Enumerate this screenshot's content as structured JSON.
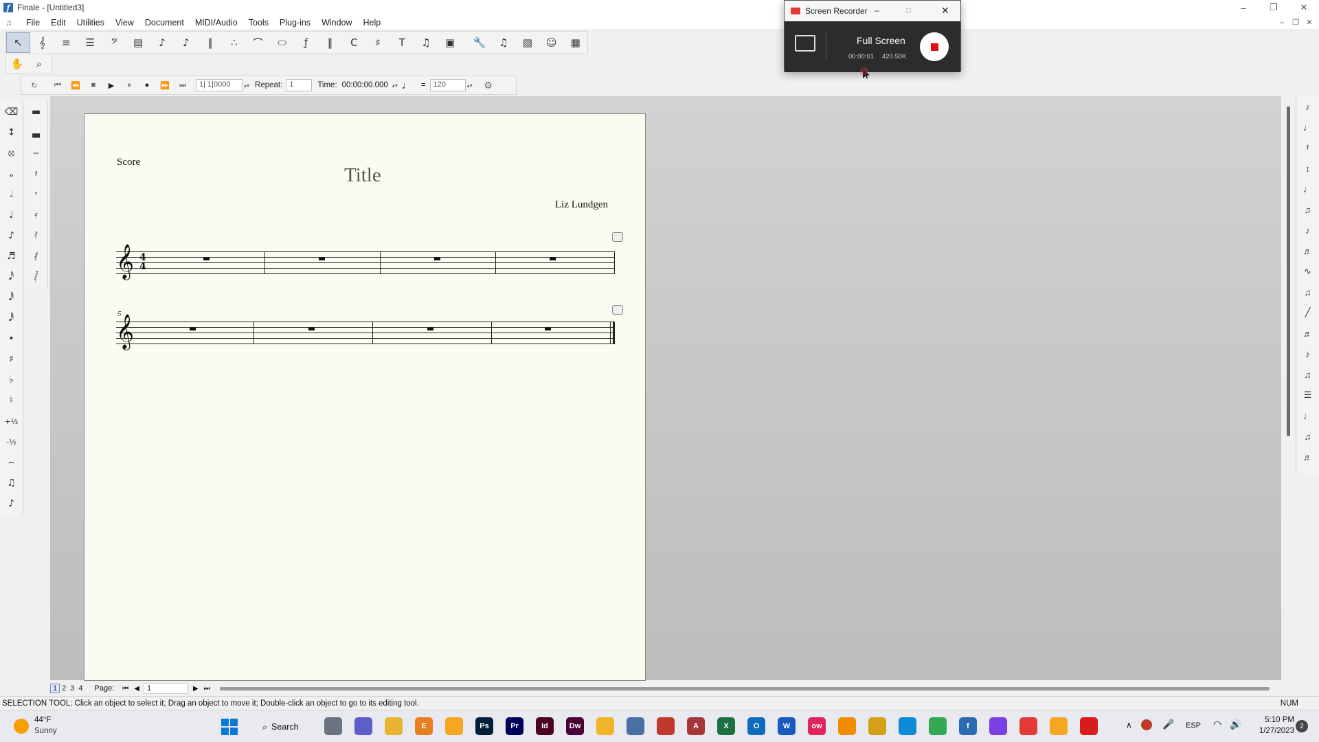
{
  "window": {
    "title": "Finale - [Untitled3]",
    "controls": [
      "minimize",
      "restore",
      "close"
    ]
  },
  "menu": [
    "File",
    "Edit",
    "Utilities",
    "View",
    "Document",
    "MIDI/Audio",
    "Tools",
    "Plug-ins",
    "Window",
    "Help"
  ],
  "main_tools": [
    "select-tool",
    "staff-tool",
    "simple-entry-tool",
    "speedy-entry-tool",
    "key-signature-tool",
    "measure-tool",
    "note-tool",
    "articulation-tool",
    "tuplet-tool",
    "smart-shape-tool",
    "expression-tool",
    "repeat-tool",
    "chord-tool",
    "lyrics-tool",
    "text-tool",
    "mirror-tool",
    "graphics-tool",
    "wrench-tool",
    "midi-tool",
    "resize-tool",
    "special-tools",
    "chord-grid-tool"
  ],
  "secondary_tools": [
    "hand-grabber-tool",
    "zoom-tool"
  ],
  "playback": {
    "position": "1| 1|0000",
    "repeat_label": "Repeat:",
    "repeat_value": "1",
    "time_label": "Time:",
    "time_value": "00:00:00.000",
    "equals": "=",
    "tempo": "120"
  },
  "score": {
    "part_label": "Score",
    "title": "Title",
    "composer": "Liz Lundgen",
    "time_signature_top": "4",
    "time_signature_bottom": "4",
    "measure_number_system2": "5",
    "measures_per_system": 4,
    "systems": 2
  },
  "page_nav": {
    "pages": [
      "1",
      "2",
      "3",
      "4"
    ],
    "current_page": "1",
    "label": "Page:",
    "page_value": "1"
  },
  "status": {
    "message": "SELECTION TOOL: Click an object to select it; Drag an object to move it; Double-click an object to go to its editing tool.",
    "num": "NUM"
  },
  "recorder": {
    "title": "Screen Recorder",
    "mode": "Full Screen",
    "elapsed": "00:00:01",
    "size": "420.50K"
  },
  "taskbar": {
    "weather_temp": "44°F",
    "weather_desc": "Sunny",
    "search_label": "Search",
    "lang": "ESP",
    "time": "5:10 PM",
    "date": "1/27/2023",
    "notification_count": "2",
    "apps": [
      {
        "name": "task-view",
        "color": "#6b7280",
        "label": ""
      },
      {
        "name": "teams",
        "color": "#5b5fc7",
        "label": ""
      },
      {
        "name": "file-explorer",
        "color": "#e8b533",
        "label": ""
      },
      {
        "name": "e-app",
        "color": "#e67e22",
        "label": "E"
      },
      {
        "name": "sublime",
        "color": "#f5a623",
        "label": ""
      },
      {
        "name": "photoshop",
        "color": "#001e36",
        "label": "Ps"
      },
      {
        "name": "premiere",
        "color": "#00005b",
        "label": "Pr"
      },
      {
        "name": "indesign",
        "color": "#49021f",
        "label": "Id"
      },
      {
        "name": "dreamweaver",
        "color": "#470137",
        "label": "Dw"
      },
      {
        "name": "duck-app",
        "color": "#f0b429",
        "label": ""
      },
      {
        "name": "calculator",
        "color": "#4a6fa5",
        "label": ""
      },
      {
        "name": "red-app",
        "color": "#c0392b",
        "label": ""
      },
      {
        "name": "access",
        "color": "#a4373a",
        "label": "A"
      },
      {
        "name": "excel",
        "color": "#1d6f42",
        "label": "X"
      },
      {
        "name": "outlook",
        "color": "#0f6cbd",
        "label": "O"
      },
      {
        "name": "word",
        "color": "#185abd",
        "label": "W"
      },
      {
        "name": "ow-app",
        "color": "#e0245e",
        "label": "ow"
      },
      {
        "name": "vlc",
        "color": "#f08c00",
        "label": ""
      },
      {
        "name": "notes-app",
        "color": "#d4a017",
        "label": ""
      },
      {
        "name": "edge",
        "color": "#0c8ad6",
        "label": ""
      },
      {
        "name": "chrome",
        "color": "#34a853",
        "label": ""
      },
      {
        "name": "finale",
        "color": "#2b6cb0",
        "label": "f"
      },
      {
        "name": "arc-app",
        "color": "#7b3fe4",
        "label": ""
      },
      {
        "name": "recorder-app",
        "color": "#e53935",
        "label": ""
      },
      {
        "name": "sublime-2",
        "color": "#f5a623",
        "label": ""
      },
      {
        "name": "acrobat",
        "color": "#d81b1b",
        "label": ""
      }
    ]
  }
}
